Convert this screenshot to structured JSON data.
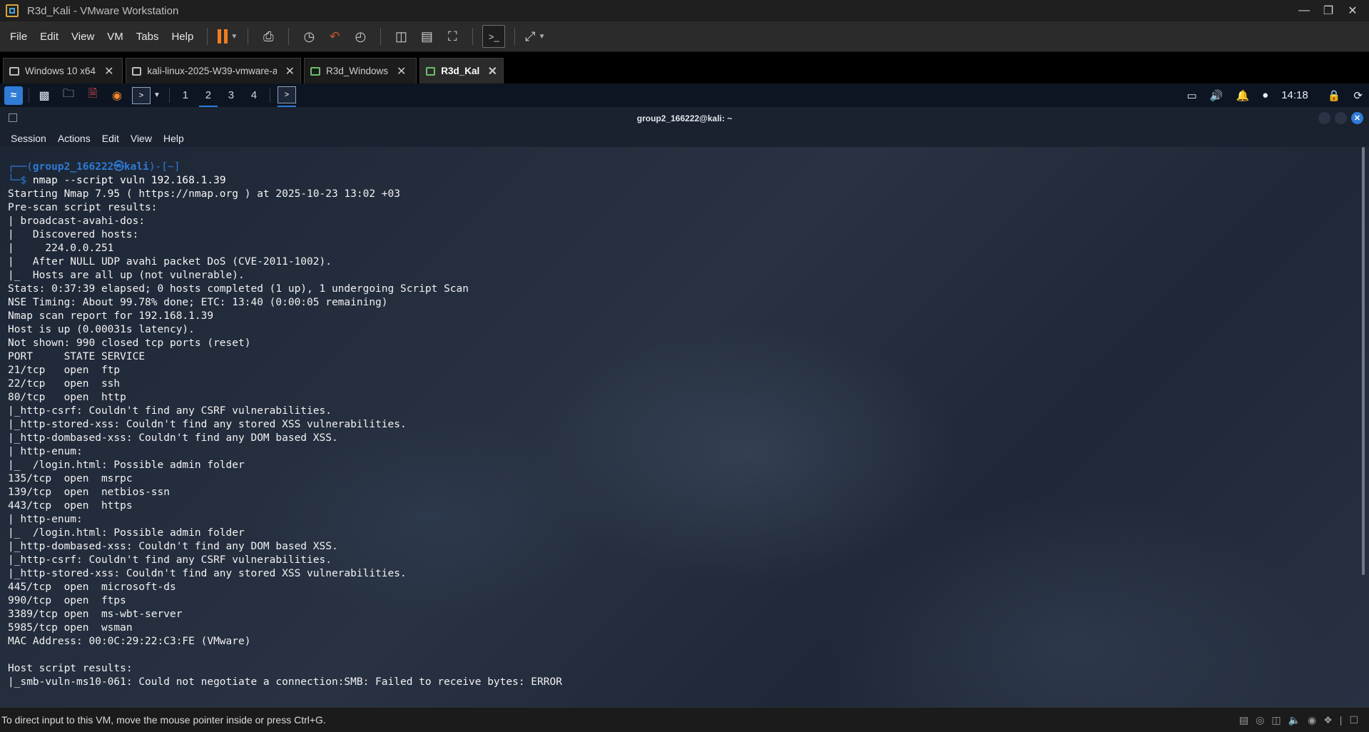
{
  "window": {
    "title": "R3d_Kali - VMware Workstation"
  },
  "menu": [
    "File",
    "Edit",
    "View",
    "VM",
    "Tabs",
    "Help"
  ],
  "tabs": [
    {
      "label": "Windows 10 x64",
      "active": false
    },
    {
      "label": "kali-linux-2025-W39-vmware-a...",
      "active": false
    },
    {
      "label": "R3d_Windows",
      "active": false
    },
    {
      "label": "R3d_Kali",
      "active": true
    }
  ],
  "kali_panel": {
    "workspaces": [
      "1",
      "2",
      "3",
      "4"
    ],
    "active_workspace": "2",
    "clock": "14:18"
  },
  "terminal": {
    "title": "group2_166222@kali: ~",
    "menu": [
      "Session",
      "Actions",
      "Edit",
      "View",
      "Help"
    ],
    "prompt_top": "┌──(",
    "prompt_user": "group2_166222㉿kali",
    "prompt_dir": ")-[~]",
    "prompt_bottom": "└─$ ",
    "command": "nmap --script vuln 192.168.1.39",
    "output": "Starting Nmap 7.95 ( https://nmap.org ) at 2025-10-23 13:02 +03\nPre-scan script results:\n| broadcast-avahi-dos:\n|   Discovered hosts:\n|     224.0.0.251\n|   After NULL UDP avahi packet DoS (CVE-2011-1002).\n|_  Hosts are all up (not vulnerable).\nStats: 0:37:39 elapsed; 0 hosts completed (1 up), 1 undergoing Script Scan\nNSE Timing: About 99.78% done; ETC: 13:40 (0:00:05 remaining)\nNmap scan report for 192.168.1.39\nHost is up (0.00031s latency).\nNot shown: 990 closed tcp ports (reset)\nPORT     STATE SERVICE\n21/tcp   open  ftp\n22/tcp   open  ssh\n80/tcp   open  http\n|_http-csrf: Couldn't find any CSRF vulnerabilities.\n|_http-stored-xss: Couldn't find any stored XSS vulnerabilities.\n|_http-dombased-xss: Couldn't find any DOM based XSS.\n| http-enum:\n|_  /login.html: Possible admin folder\n135/tcp  open  msrpc\n139/tcp  open  netbios-ssn\n443/tcp  open  https\n| http-enum:\n|_  /login.html: Possible admin folder\n|_http-dombased-xss: Couldn't find any DOM based XSS.\n|_http-csrf: Couldn't find any CSRF vulnerabilities.\n|_http-stored-xss: Couldn't find any stored XSS vulnerabilities.\n445/tcp  open  microsoft-ds\n990/tcp  open  ftps\n3389/tcp open  ms-wbt-server\n5985/tcp open  wsman\nMAC Address: 00:0C:29:22:C3:FE (VMware)\n\nHost script results:\n|_smb-vuln-ms10-061: Could not negotiate a connection:SMB: Failed to receive bytes: ERROR"
  },
  "statusbar": {
    "text": "To direct input to this VM, move the mouse pointer inside or press Ctrl+G."
  },
  "colors": {
    "prompt": "#2e7bd6",
    "accent_pause": "#ef7d22",
    "kali_blue": "#2f7cd6"
  }
}
